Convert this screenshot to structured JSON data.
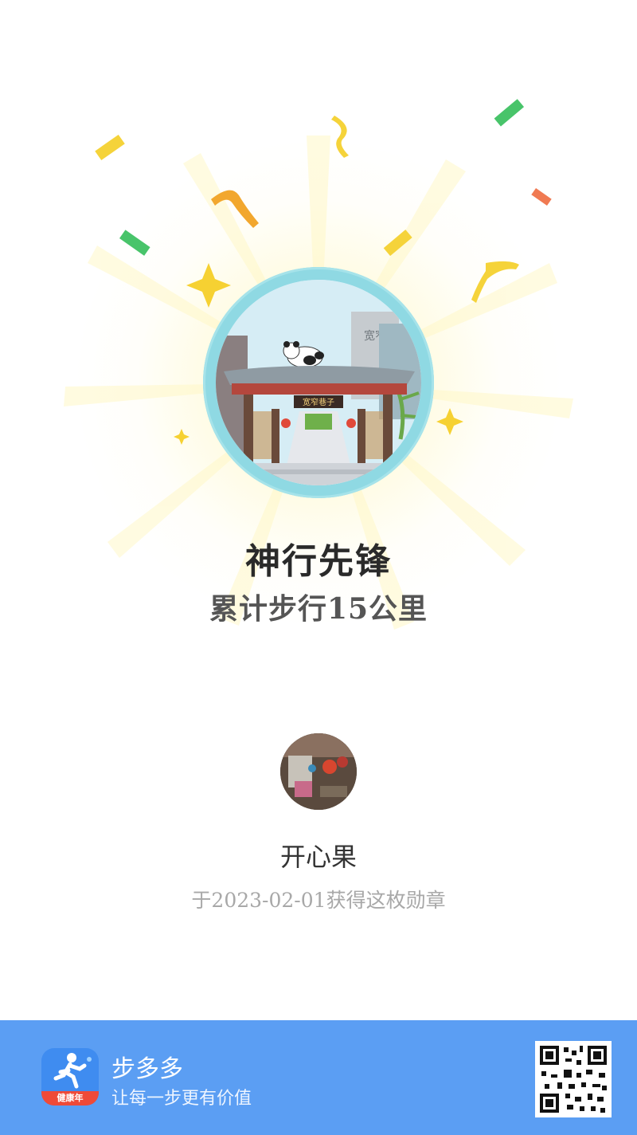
{
  "badge": {
    "title": "神行先锋",
    "subtitle": "累计步行15公里",
    "sign_text": "宽窄巷子",
    "tower_text": "宽窄"
  },
  "user": {
    "name": "开心果",
    "earned_text": "于2023-02-01获得这枚勋章"
  },
  "footer": {
    "app_name": "步多多",
    "slogan": "让每一步更有价值",
    "icon_tag": "健康年"
  },
  "icons": [
    "running-person-icon",
    "qr-code-icon",
    "sparkle-icon",
    "confetti-icon",
    "panda-icon"
  ],
  "colors": {
    "accent": "#5b9ef3",
    "badge_ring": "#8fd9e3",
    "confetti_yellow": "#f5d33a",
    "confetti_green": "#48c46a",
    "confetti_orange": "#f39a2d"
  }
}
